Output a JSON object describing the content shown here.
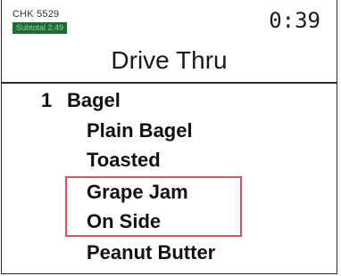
{
  "header": {
    "check_number": "CHK 5529",
    "subtotal": "Subtotal 2.49",
    "timer": "0:39",
    "title": "Drive Thru"
  },
  "order": {
    "item": {
      "quantity": "1",
      "name": "Bagel"
    },
    "modifiers": [
      "Plain Bagel",
      "Toasted",
      "Grape Jam",
      "On Side",
      "Peanut Butter"
    ]
  },
  "colors": {
    "subtotal_bg": "#1d6b36",
    "highlight": "#e0505a"
  }
}
